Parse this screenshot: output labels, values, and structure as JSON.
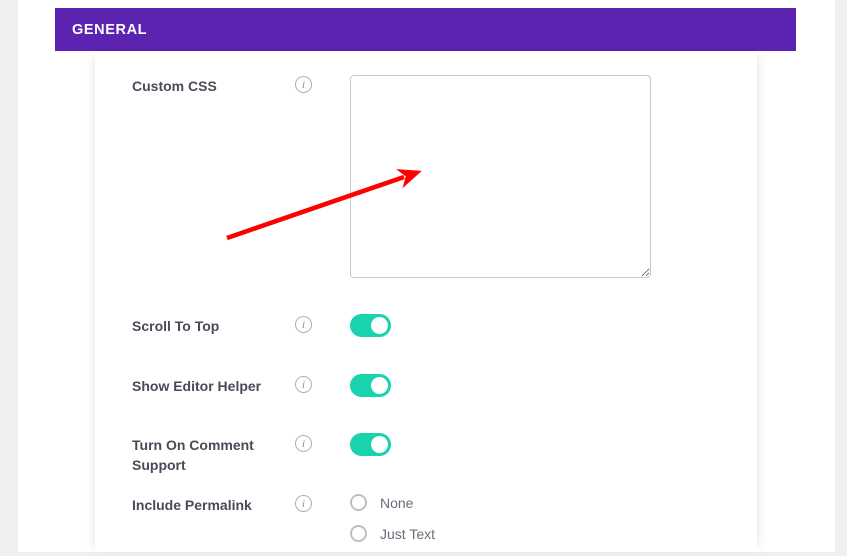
{
  "section": {
    "title": "GENERAL",
    "header_color": "#5c22b0"
  },
  "theme": {
    "toggle_on_color": "#19d3ae",
    "annotation_color": "#ff0000",
    "label_color": "#4a4a58"
  },
  "fields": {
    "custom_css": {
      "label": "Custom CSS",
      "info_icon": "info-icon",
      "value": "",
      "placeholder": ""
    },
    "scroll_to_top": {
      "label": "Scroll To Top",
      "info_icon": "info-icon",
      "state": "on"
    },
    "show_editor_helper": {
      "label": "Show Editor Helper",
      "info_icon": "info-icon",
      "state": "on"
    },
    "turn_on_comment_support": {
      "label": "Turn On Comment Support",
      "info_icon": "info-icon",
      "state": "on"
    },
    "include_permalink": {
      "label": "Include Permalink",
      "info_icon": "info-icon",
      "options": [
        {
          "label": "None",
          "selected": false
        },
        {
          "label": "Just Text",
          "selected": false
        }
      ]
    }
  },
  "annotation": {
    "type": "arrow",
    "points_to": "custom-css-textarea",
    "color": "#ff0000"
  }
}
